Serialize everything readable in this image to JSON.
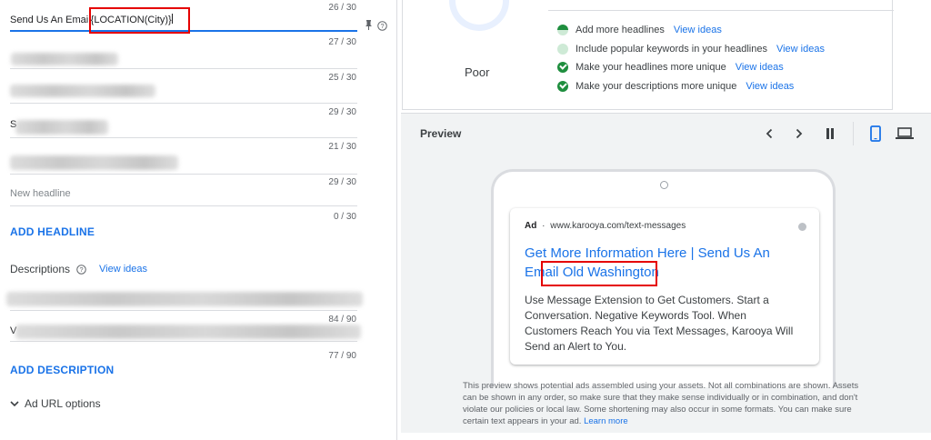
{
  "headlines": [
    {
      "value": "Send Us An Email",
      "insert_tag": "{LOCATION(City)}",
      "counter": "26 / 30"
    },
    {
      "counter": "27 / 30"
    },
    {
      "counter": "25 / 30"
    },
    {
      "partial_text": "S",
      "counter": "29 / 30"
    },
    {
      "counter": "21 / 30"
    },
    {
      "placeholder": "New headline",
      "counter": "29 / 30"
    }
  ],
  "add_headline_counter": "0 / 30",
  "add_headline_label": "ADD HEADLINE",
  "descriptions": {
    "label": "Descriptions",
    "view_ideas": "View ideas",
    "items": [
      {
        "counter": "84 / 90",
        "partial_text": "V"
      },
      {
        "counter": "77 / 90"
      }
    ]
  },
  "add_description_label": "ADD DESCRIPTION",
  "ad_url_options": "Ad URL options",
  "ad_strength": {
    "rating": "Poor",
    "tips": [
      {
        "text": "Add more headlines",
        "link": "View ideas",
        "status": "half"
      },
      {
        "text": "Include popular keywords in your headlines",
        "link": "View ideas",
        "status": "todo"
      },
      {
        "text": "Make your headlines more unique",
        "link": "View ideas",
        "status": "done"
      },
      {
        "text": "Make your descriptions more unique",
        "link": "View ideas",
        "status": "done"
      }
    ]
  },
  "preview": {
    "title": "Preview",
    "ad_label": "Ad",
    "separator": "·",
    "display_url": "www.karooya.com/text-messages",
    "headline_main": "Get More Information Here | Send Us An Email",
    "headline_location": "Old Washington",
    "description": "Use Message Extension to Get Customers. Start a Conversation. Negative Keywords Tool. When Customers Reach You via Text Messages, Karooya Will Send an Alert to You.",
    "disclaimer": "This preview shows potential ads assembled using your assets. Not all combinations are shown. Assets can be shown in any order, so make sure that they make sense individually or in combination, and don't violate our policies or local law. Some shortening may also occur in some formats. You can make sure certain text appears in your ad.",
    "learn_more": "Learn more"
  },
  "colors": {
    "link": "#1a73e8",
    "highlight_box": "#e50000",
    "success": "#1e8e3e"
  },
  "icons": [
    "pin-icon",
    "help-icon",
    "chevron-left-icon",
    "chevron-right-icon",
    "pause-icon",
    "mobile-icon",
    "desktop-icon",
    "chevron-down-icon"
  ]
}
